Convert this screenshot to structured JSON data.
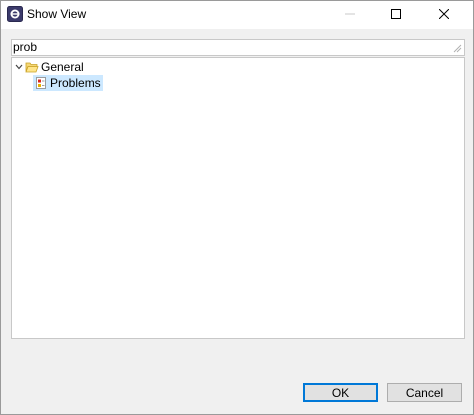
{
  "window": {
    "title": "Show View",
    "icon": "eclipse-icon"
  },
  "titlebar_buttons": {
    "minimize": "minimize-icon",
    "maximize": "maximize-icon",
    "close": "close-icon"
  },
  "filter": {
    "value": "prob",
    "clear_icon": "clear-filter-icon"
  },
  "tree": {
    "items": [
      {
        "label": "General",
        "icon": "folder-open-icon",
        "expanded": true,
        "children": [
          {
            "label": "Problems",
            "icon": "problems-view-icon",
            "selected": true
          }
        ]
      }
    ]
  },
  "buttons": {
    "ok_label": "OK",
    "cancel_label": "Cancel"
  },
  "colors": {
    "selection": "#cce8ff",
    "accent": "#0078d7",
    "background": "#f0f0f0"
  }
}
